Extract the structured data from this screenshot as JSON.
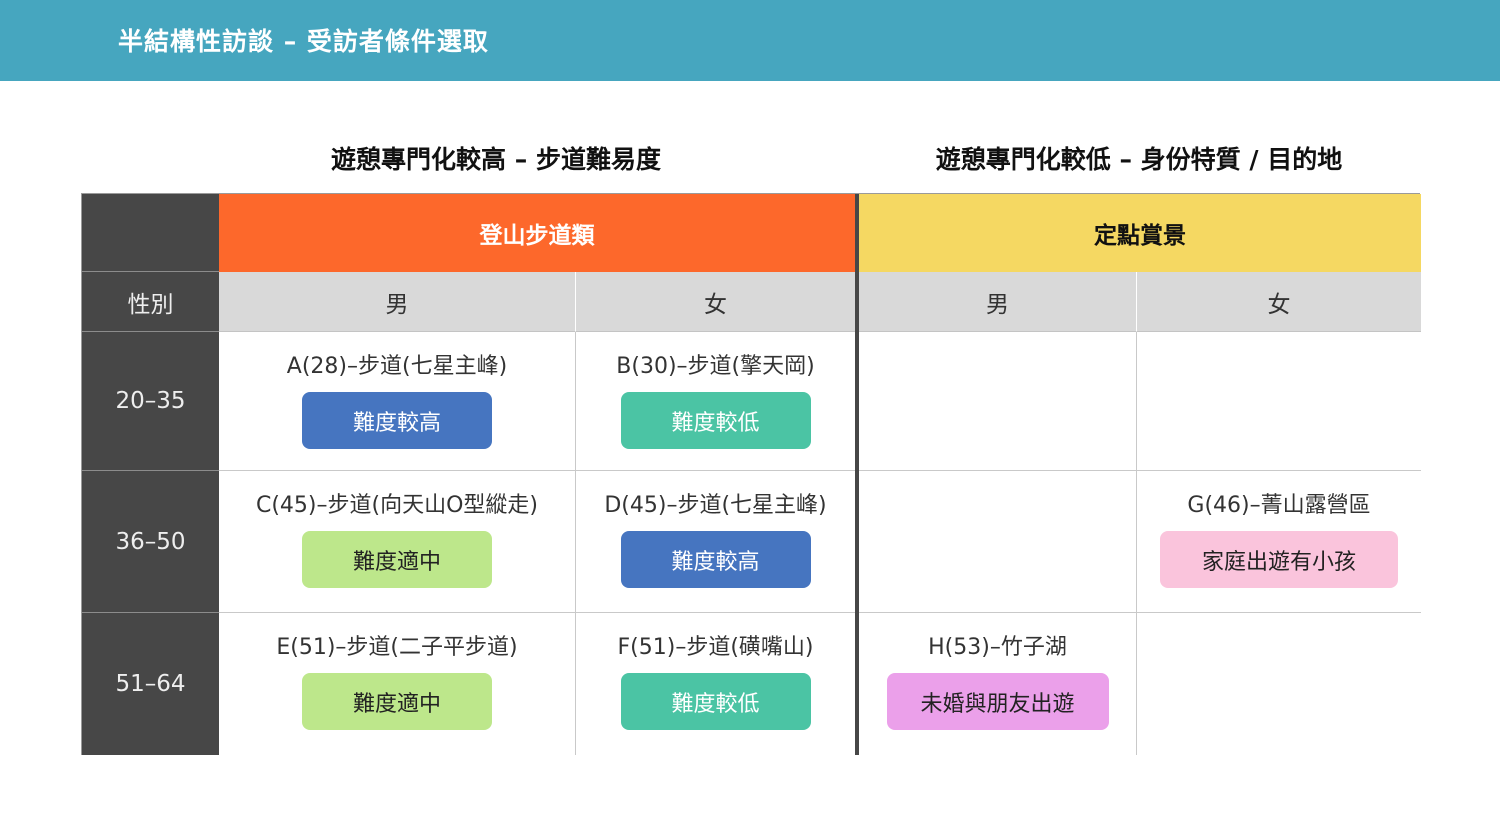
{
  "header": {
    "title": "半結構性訪談 – 受訪者條件選取"
  },
  "headings": {
    "left": "遊憩專門化較高 – 步道難易度",
    "right": "遊憩專門化較低 – 身份特質 / 目的地"
  },
  "table": {
    "categories": [
      "登山步道類",
      "定點賞景"
    ],
    "gender_row_label": "性別",
    "genders": [
      "男",
      "女",
      "男",
      "女"
    ],
    "age_groups": [
      "20–35",
      "36–50",
      "51–64"
    ],
    "cells": {
      "r1c1": {
        "name": "A(28)–步道(七星主峰)",
        "tag": "難度較高"
      },
      "r1c2": {
        "name": "B(30)–步道(擎天岡)",
        "tag": "難度較低"
      },
      "r2c1": {
        "name": "C(45)–步道(向天山O型縱走)",
        "tag": "難度適中"
      },
      "r2c2": {
        "name": "D(45)–步道(七星主峰)",
        "tag": "難度較高"
      },
      "r2c4": {
        "name": "G(46)–菁山露營區",
        "tag": "家庭出遊有小孩"
      },
      "r3c1": {
        "name": "E(51)–步道(二子平步道)",
        "tag": "難度適中"
      },
      "r3c2": {
        "name": "F(51)–步道(磺嘴山)",
        "tag": "難度較低"
      },
      "r3c3": {
        "name": "H(53)–竹子湖",
        "tag": "未婚與朋友出遊"
      }
    }
  },
  "colors": {
    "header_bar": "#46a6bf",
    "category_hiking": "#fd682b",
    "category_scenic": "#f5d862",
    "tag_high": "#4675c0",
    "tag_low": "#4bc4a4",
    "tag_medium": "#bde78b",
    "tag_family": "#fac4dc",
    "tag_friends": "#eba0ea"
  }
}
